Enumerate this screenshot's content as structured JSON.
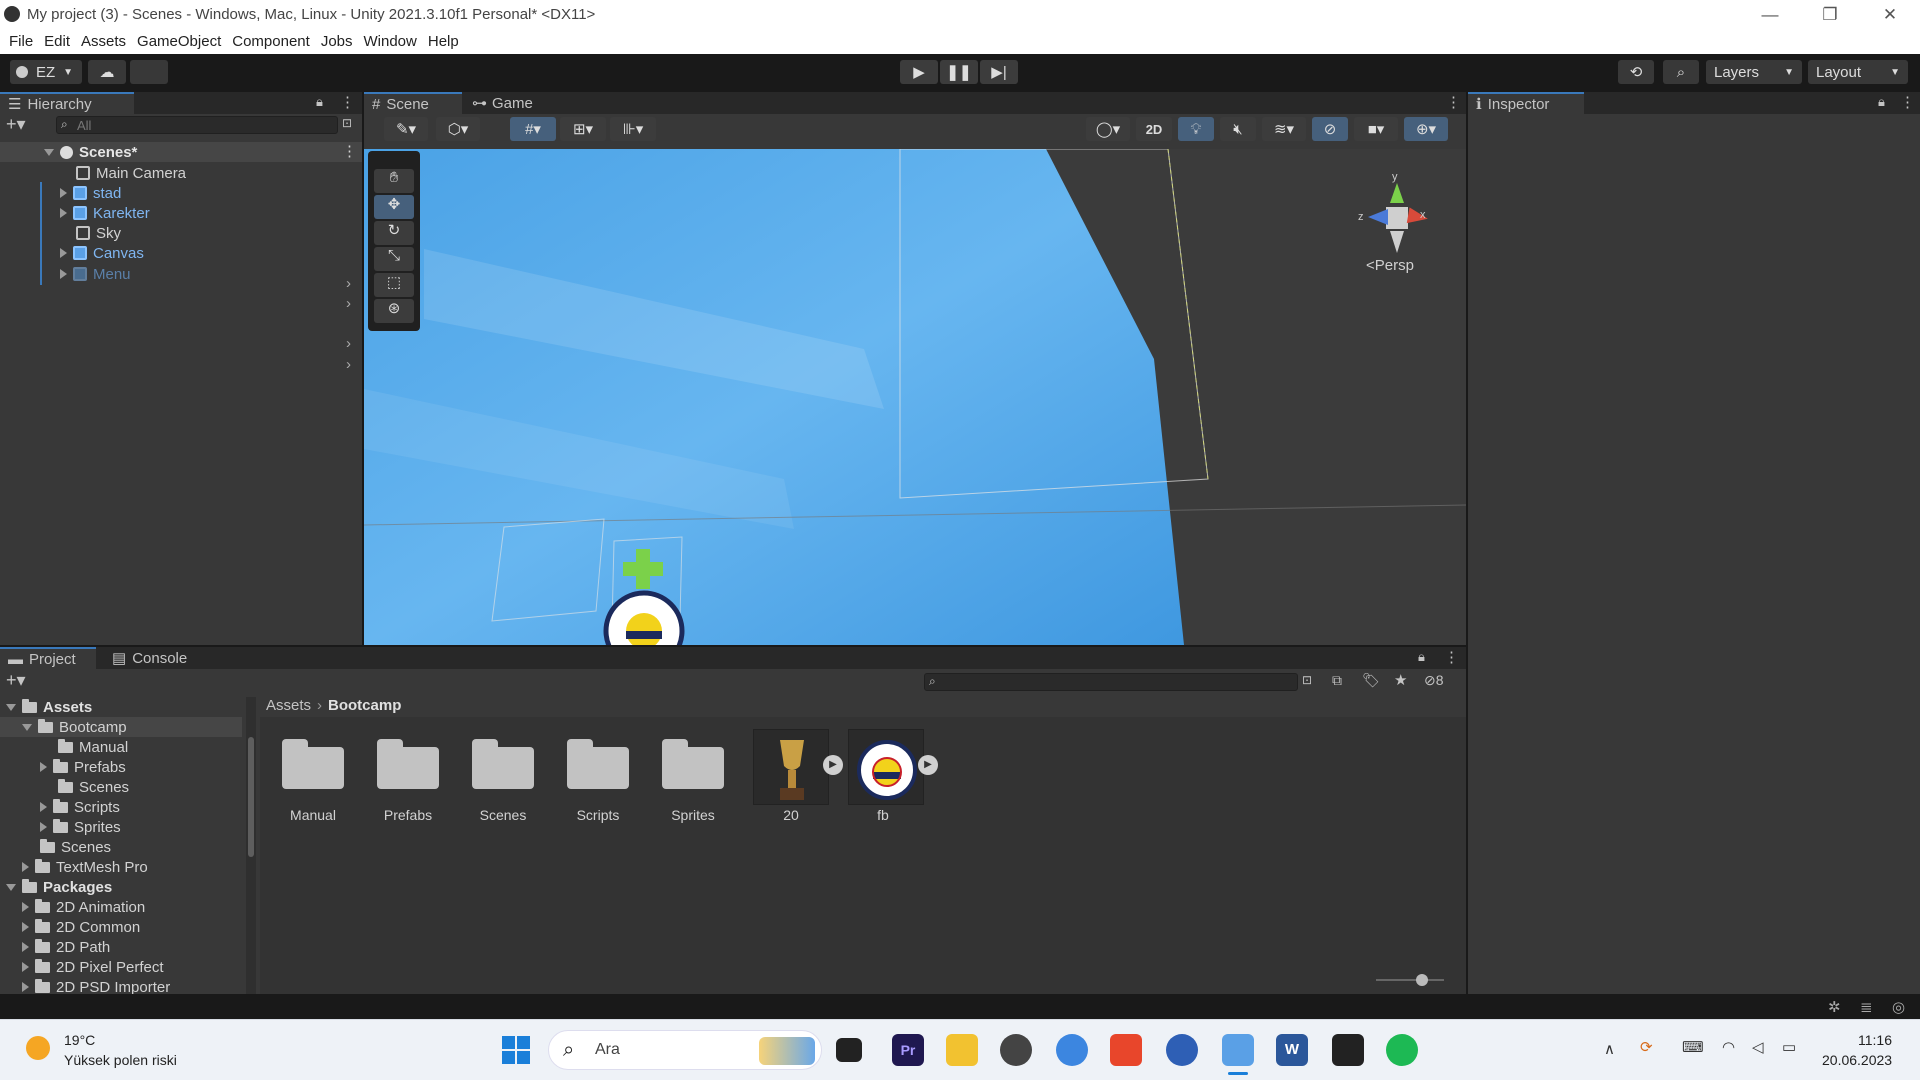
{
  "window": {
    "title": "My project (3) - Scenes - Windows, Mac, Linux - Unity 2021.3.10f1 Personal* <DX11>",
    "minimize_glyph": "—",
    "restore_glyph": "❐",
    "close_glyph": "✕"
  },
  "menu": [
    "File",
    "Edit",
    "Assets",
    "GameObject",
    "Component",
    "Jobs",
    "Window",
    "Help"
  ],
  "toolbar": {
    "account_label": "EZ",
    "layers_label": "Layers",
    "layout_label": "Layout"
  },
  "hierarchy": {
    "tab_label": "Hierarchy",
    "search_placeholder": "All",
    "scene_name": "Scenes*",
    "items": [
      {
        "label": "Main Camera",
        "style": "normal",
        "has_children": false
      },
      {
        "label": "stad",
        "style": "prefab",
        "has_children": true
      },
      {
        "label": "Karekter",
        "style": "prefab",
        "has_children": true
      },
      {
        "label": "Sky",
        "style": "normal",
        "has_children": false
      },
      {
        "label": "Canvas",
        "style": "prefab",
        "has_children": true
      },
      {
        "label": "Menu",
        "style": "disabled-prefab",
        "has_children": true
      }
    ]
  },
  "scene_view": {
    "tabs": [
      "Scene",
      "Game"
    ],
    "active_tab": "Scene",
    "toggle_2d": "2D",
    "projection_label": "Persp",
    "gizmo_axes": {
      "y": "y",
      "x": "x",
      "z": "z"
    }
  },
  "inspector": {
    "tab_label": "Inspector"
  },
  "project": {
    "tabs": [
      "Project",
      "Console"
    ],
    "hidden_count": "8",
    "breadcrumb": [
      "Assets",
      "Bootcamp"
    ],
    "tree": [
      {
        "label": "Assets",
        "level": 0,
        "bold": true,
        "expanded": true
      },
      {
        "label": "Bootcamp",
        "level": 1,
        "expanded": true,
        "selected": true
      },
      {
        "label": "Manual",
        "level": 2
      },
      {
        "label": "Prefabs",
        "level": 2,
        "collapsed": true
      },
      {
        "label": "Scenes",
        "level": 2
      },
      {
        "label": "Scripts",
        "level": 2,
        "collapsed": true
      },
      {
        "label": "Sprites",
        "level": 2,
        "collapsed": true
      },
      {
        "label": "Scenes",
        "level": 1
      },
      {
        "label": "TextMesh Pro",
        "level": 1,
        "collapsed": true
      },
      {
        "label": "Packages",
        "level": 0,
        "bold": true,
        "expanded": true
      },
      {
        "label": "2D Animation",
        "level": 1,
        "collapsed": true
      },
      {
        "label": "2D Common",
        "level": 1,
        "collapsed": true
      },
      {
        "label": "2D Path",
        "level": 1,
        "collapsed": true
      },
      {
        "label": "2D Pixel Perfect",
        "level": 1,
        "collapsed": true
      },
      {
        "label": "2D PSD Importer",
        "level": 1,
        "collapsed": true
      }
    ],
    "assets": [
      {
        "label": "Manual",
        "kind": "folder"
      },
      {
        "label": "Prefabs",
        "kind": "folder"
      },
      {
        "label": "Scenes",
        "kind": "folder"
      },
      {
        "label": "Scripts",
        "kind": "folder"
      },
      {
        "label": "Sprites",
        "kind": "folder"
      },
      {
        "label": "20",
        "kind": "sprite-trophy"
      },
      {
        "label": "fb",
        "kind": "sprite-badge"
      }
    ]
  },
  "taskbar": {
    "weather_temp": "19°C",
    "weather_desc": "Yüksek polen riski",
    "search_placeholder": "Ara",
    "time": "11:16",
    "date": "20.06.2023"
  }
}
